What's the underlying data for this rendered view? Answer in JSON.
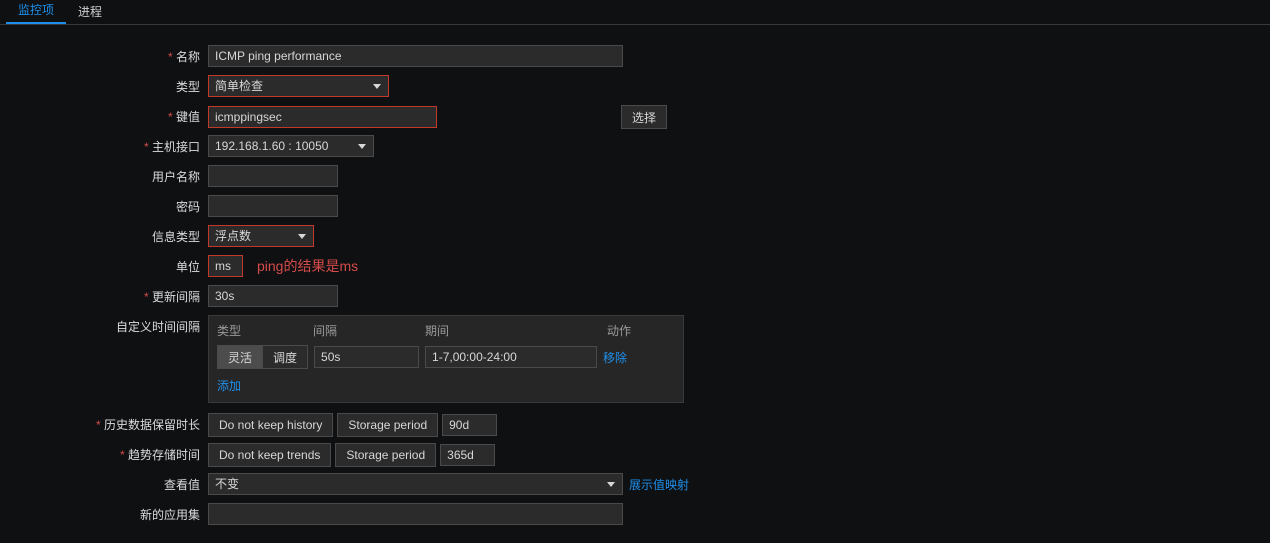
{
  "tabs": {
    "items": [
      "监控项",
      "进程"
    ],
    "active": 0
  },
  "labels": {
    "name": "名称",
    "type": "类型",
    "key": "键值",
    "host_iface": "主机接口",
    "username": "用户名称",
    "password": "密码",
    "info_type": "信息类型",
    "unit": "单位",
    "update_interval": "更新间隔",
    "custom_interval": "自定义时间间隔",
    "history": "历史数据保留时长",
    "trends": "趋势存储时间",
    "show_value": "查看值",
    "new_appset": "新的应用集"
  },
  "form": {
    "name": "ICMP ping performance",
    "type": "简单检查",
    "key": "icmppingsec",
    "key_select_btn": "选择",
    "host_iface": "192.168.1.60 : 10050",
    "username": "",
    "password": "",
    "info_type": "浮点数",
    "unit": "ms",
    "unit_annotation": "ping的结果是ms",
    "update_interval": "30s"
  },
  "custom_interval": {
    "headers": {
      "type": "类型",
      "interval": "间隔",
      "period": "期间",
      "action": "动作"
    },
    "seg": {
      "flexible": "灵活",
      "scheduling": "调度"
    },
    "interval": "50s",
    "period": "1-7,00:00-24:00",
    "remove": "移除",
    "add": "添加"
  },
  "history": {
    "btn_no_keep": "Do not keep history",
    "btn_storage": "Storage period",
    "value": "90d"
  },
  "trends": {
    "btn_no_keep": "Do not keep trends",
    "btn_storage": "Storage period",
    "value": "365d"
  },
  "show_value": {
    "value": "不变",
    "link": "展示值映射"
  },
  "new_appset": ""
}
